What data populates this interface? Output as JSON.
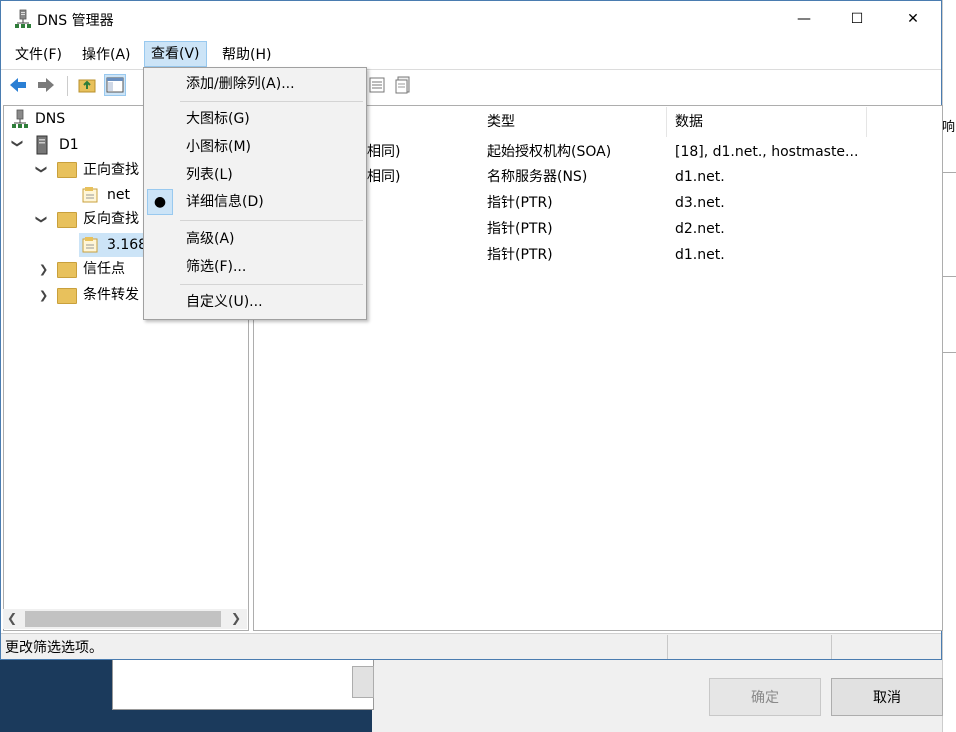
{
  "window": {
    "title": "DNS 管理器",
    "controls": {
      "minimize": "—",
      "maximize": "☐",
      "close": "✕"
    }
  },
  "menubar": [
    {
      "label": "文件(F)"
    },
    {
      "label": "操作(A)"
    },
    {
      "label": "查看(V)"
    },
    {
      "label": "帮助(H)"
    }
  ],
  "view_menu": {
    "items": [
      {
        "label": "添加/删除列(A)..."
      },
      {
        "label": "大图标(G)"
      },
      {
        "label": "小图标(M)"
      },
      {
        "label": "列表(L)"
      },
      {
        "label": "详细信息(D)",
        "checked": true
      },
      {
        "label": "高级(A)"
      },
      {
        "label": "筛选(F)..."
      },
      {
        "label": "自定义(U)..."
      }
    ],
    "bullet": "●"
  },
  "tree": {
    "root": "DNS",
    "server": "D1",
    "nodes": [
      {
        "label": "正向查找",
        "expanded": true
      },
      {
        "label": "net"
      },
      {
        "label": "反向查找",
        "expanded": true
      },
      {
        "label": "3.168",
        "selected": true
      },
      {
        "label": "信任点",
        "expanded": false
      },
      {
        "label": "条件转发",
        "expanded": false
      }
    ]
  },
  "list": {
    "columns": [
      "类型",
      "数据"
    ],
    "rows": [
      {
        "name": "相同)",
        "type": "起始授权机构(SOA)",
        "data": "[18], d1.net., hostmaste..."
      },
      {
        "name": "相同)",
        "type": "名称服务器(NS)",
        "data": "d1.net."
      },
      {
        "name": "",
        "type": "指针(PTR)",
        "data": "d3.net."
      },
      {
        "name": "",
        "type": "指针(PTR)",
        "data": "d2.net."
      },
      {
        "name": "",
        "type": "指针(PTR)",
        "data": "d1.net."
      }
    ]
  },
  "status": {
    "text": "更改筛选选项。"
  },
  "background_dialog": {
    "side_char": "响",
    "ok_label": "确定",
    "cancel_label": "取消"
  }
}
